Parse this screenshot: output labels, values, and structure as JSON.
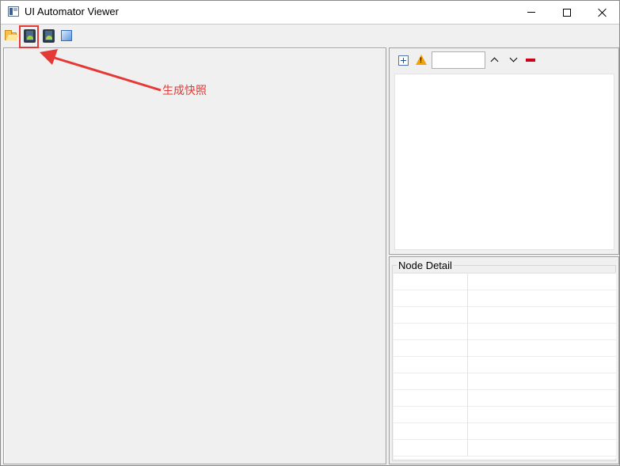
{
  "window": {
    "title": "UI Automator Viewer"
  },
  "toolbar": {
    "buttons": [
      {
        "icon": "open-folder-icon"
      },
      {
        "icon": "device-screenshot-icon"
      },
      {
        "icon": "device-screenshot-compressed-icon"
      },
      {
        "icon": "save-icon"
      }
    ]
  },
  "hierarchy": {
    "filter_value": ""
  },
  "node_detail": {
    "label": "Node Detail",
    "rows": 11
  },
  "annotation": {
    "text": "生成快照",
    "color": "#e53935"
  },
  "colors": {
    "background": "#f0f0f0",
    "annotation": "#e53935"
  }
}
